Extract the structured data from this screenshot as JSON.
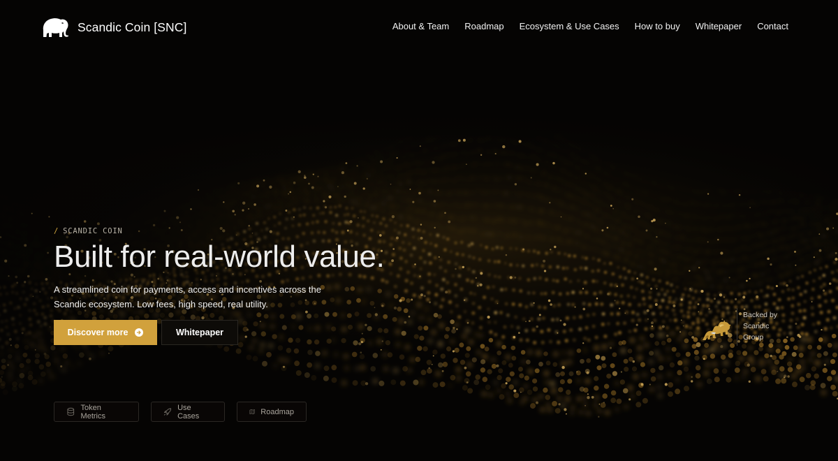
{
  "brand": {
    "name": "Scandic Coin [SNC]",
    "logo_icon": "mammoth-icon"
  },
  "nav": {
    "items": [
      {
        "label": "About & Team"
      },
      {
        "label": "Roadmap"
      },
      {
        "label": "Ecosystem & Use Cases"
      },
      {
        "label": "How to buy"
      },
      {
        "label": "Whitepaper"
      },
      {
        "label": "Contact"
      }
    ]
  },
  "hero": {
    "eyebrow": "SCANDIC COIN",
    "eyebrow_prefix": "/",
    "title": "Built for real-world value.",
    "lead": "A streamlined coin for payments, access and incentives across the Scandic ecosystem. Low fees, high speed, real utility.",
    "primary_cta": "Discover more",
    "secondary_cta": "Whitepaper"
  },
  "quick_links": [
    {
      "label": "Token Metrics",
      "icon": "database-icon"
    },
    {
      "label": "Use Cases",
      "icon": "rocket-icon"
    },
    {
      "label": "Roadmap",
      "icon": "map-icon"
    }
  ],
  "backed": {
    "line1": "Backed by",
    "line2": "Scandic",
    "line3": "Group",
    "icon": "bulls-logo-icon"
  },
  "colors": {
    "accent": "#d1a13c",
    "background": "#050403",
    "particle": "#c79a3a"
  }
}
